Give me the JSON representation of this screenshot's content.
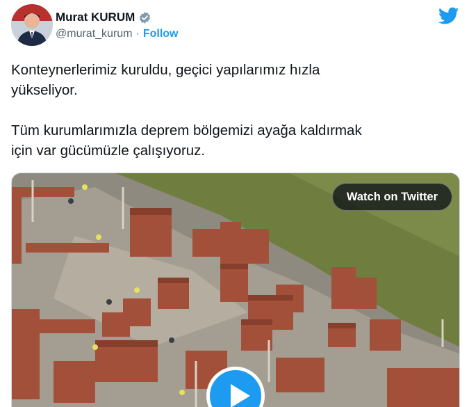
{
  "author": {
    "display_name": "Murat KURUM",
    "handle": "@murat_kurum",
    "separator": "·",
    "follow_label": "Follow",
    "verified": true
  },
  "tweet": {
    "paragraphs": [
      "Konteynerlerimiz kuruldu, geçici yapılarımız hızla\nyükseliyor.",
      "Tüm kurumlarımızla deprem bölgemizi ayağa kaldırmak\niçin var gücümüzle çalışıyoruz."
    ]
  },
  "media": {
    "watch_label": "Watch on Twitter",
    "description_icon": "play-icon"
  },
  "colors": {
    "accent": "#1d9bf0",
    "text": "#0f1419",
    "secondary": "#536471"
  }
}
